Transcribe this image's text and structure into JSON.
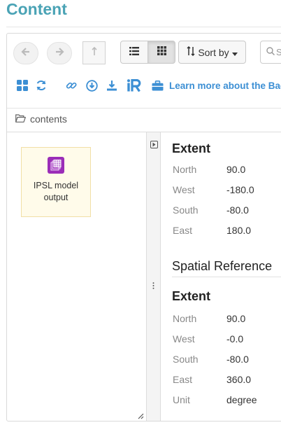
{
  "page": {
    "title": "Content"
  },
  "toolbar": {
    "sort_label": "Sort by",
    "search_placeholder": "S",
    "learn_more": "Learn more about the Bagl"
  },
  "breadcrumb": {
    "label": "contents"
  },
  "files": [
    {
      "name_line1": "IPSL model",
      "name_line2": "output",
      "icon": "multidim-file-icon",
      "color": "#9b2db8"
    }
  ],
  "metadata": {
    "extent1": {
      "title": "Extent",
      "rows": [
        {
          "label": "North",
          "value": "90.0"
        },
        {
          "label": "West",
          "value": "-180.0"
        },
        {
          "label": "South",
          "value": "-80.0"
        },
        {
          "label": "East",
          "value": "180.0"
        }
      ]
    },
    "spatial_reference": {
      "title": "Spatial Reference"
    },
    "extent2": {
      "title": "Extent",
      "rows": [
        {
          "label": "North",
          "value": "90.0"
        },
        {
          "label": "West",
          "value": "-0.0"
        },
        {
          "label": "South",
          "value": "-80.0"
        },
        {
          "label": "East",
          "value": "360.0"
        },
        {
          "label": "Unit",
          "value": "degree"
        }
      ]
    }
  },
  "colors": {
    "accent": "#4aa3b5",
    "link": "#3c8fd4",
    "tile_bg": "#fffbea"
  }
}
